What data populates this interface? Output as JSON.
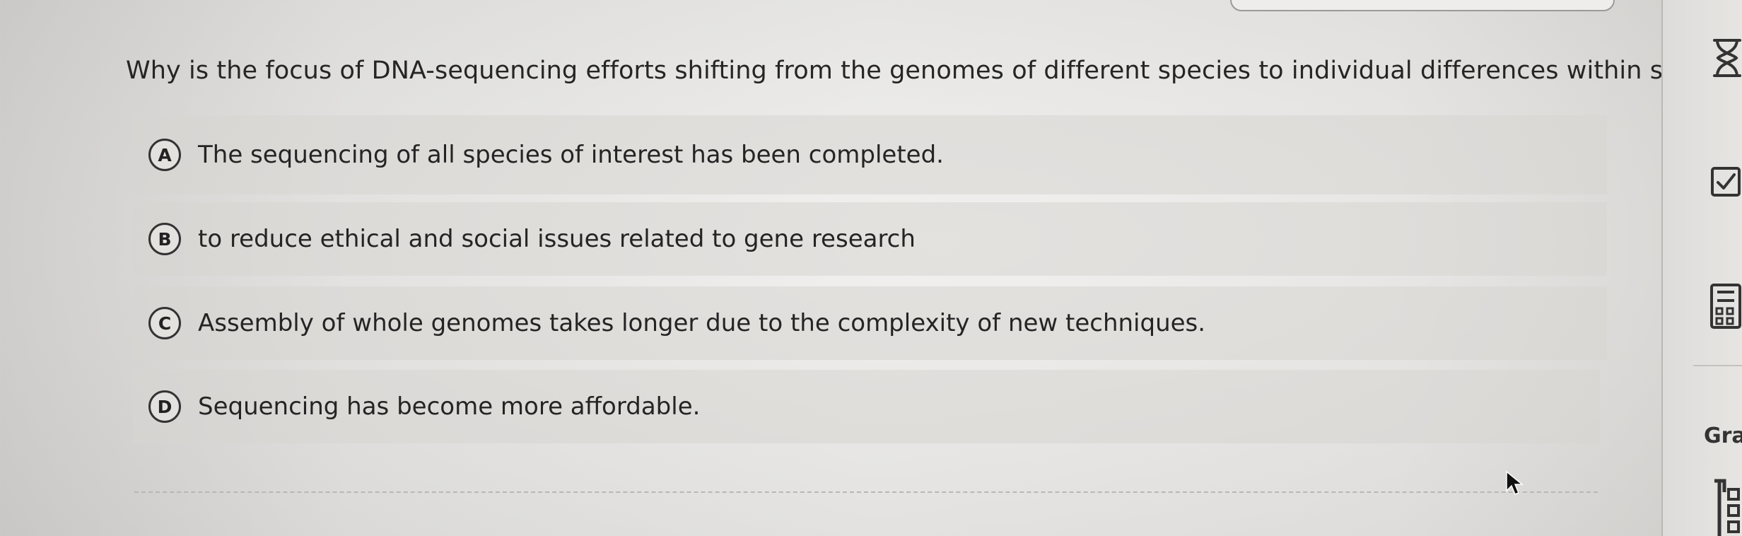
{
  "question": {
    "text": "Why is the focus of DNA-sequencing efforts shifting from the genomes of different species to individual differences within species?"
  },
  "options": [
    {
      "letter": "A",
      "text": "The sequencing of all species of interest has been completed."
    },
    {
      "letter": "B",
      "text": "to reduce ethical and social issues related to gene research"
    },
    {
      "letter": "C",
      "text": "Assembly of whole genomes takes longer due to the complexity of new techniques."
    },
    {
      "letter": "D",
      "text": "Sequencing has become more affordable."
    }
  ],
  "sidebar": {
    "grade_label": "Gra",
    "icons": [
      "hourglass-icon",
      "checkbox-icon",
      "calculator-icon",
      "report-icon"
    ]
  },
  "colors": {
    "page_background": "#efeeec",
    "option_background": "#d7d5d2",
    "text": "#252525"
  }
}
